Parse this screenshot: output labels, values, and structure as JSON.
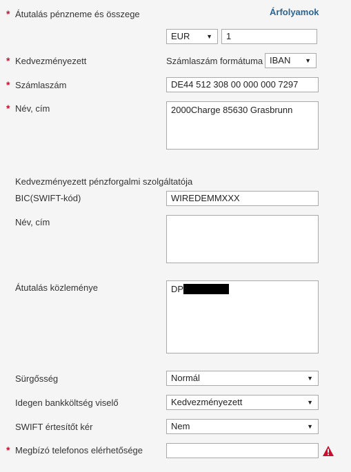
{
  "transfer_currency": {
    "label": "Átutalás pénzneme és összege",
    "rates_link": "Árfolyamok",
    "currency": "EUR",
    "amount": "1"
  },
  "beneficiary": {
    "label": "Kedvezményezett",
    "account_format_label": "Számlaszám formátuma",
    "account_format": "IBAN"
  },
  "account_number": {
    "label": "Számlaszám",
    "value": "DE44 512 308 00 000 000 7297"
  },
  "name_address": {
    "label": "Név, cím",
    "value": "2000Charge 85630 Grasbrunn"
  },
  "provider": {
    "heading": "Kedvezményezett pénzforgalmi szolgáltatója",
    "bic_label": "BIC(SWIFT-kód)",
    "bic_value": "WIREDEMMXXX",
    "name_label": "Név, cím",
    "name_value": ""
  },
  "memo": {
    "label": "Átutalás közleménye",
    "value_prefix": "DP"
  },
  "urgency": {
    "label": "Sürgősség",
    "value": "Normál"
  },
  "bank_fee": {
    "label": "Idegen bankköltség viselő",
    "value": "Kedvezményezett"
  },
  "swift_notice": {
    "label": "SWIFT értesítőt kér",
    "value": "Nem"
  },
  "phone": {
    "label": "Megbízó telefonos elérhetősége",
    "value": ""
  },
  "required_mark": "*",
  "caret": "▼",
  "colors": {
    "required": "#c8102e",
    "link": "#2a6496",
    "warning": "#c8102e"
  }
}
